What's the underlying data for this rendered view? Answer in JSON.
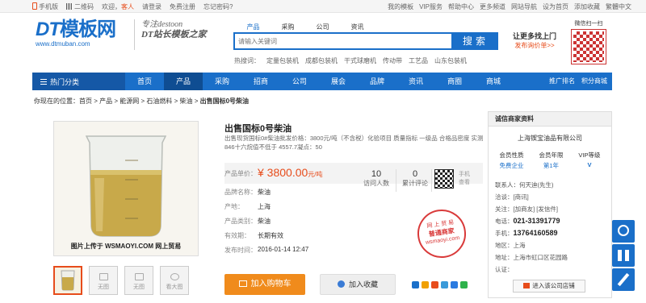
{
  "topbar": {
    "mobile": "手机版",
    "qrcode": "二维码",
    "welcome_prefix": "欢迎，",
    "guest": "客人",
    "login": "请登录",
    "register": "免费注册",
    "forgot": "忘记密码?",
    "links": [
      "我的模板",
      "VIP服务",
      "帮助中心",
      "更多频道",
      "网站导航",
      "设为首页",
      "添加收藏",
      "繁體中文"
    ]
  },
  "header": {
    "logo_text": "模板网",
    "logo_prefix": "DT",
    "logo_url": "www.dtmuban.com",
    "slogan_line1": "专注destoon",
    "slogan_line2": "DT站长模板之家",
    "search_tabs": [
      "产品",
      "采购",
      "公司",
      "资讯"
    ],
    "search_placeholder": "请输入关键词",
    "search_button": "搜索",
    "hot_label": "热搜词：",
    "hot_words": [
      "定量包装机",
      "成都包装机",
      "干式球磨机",
      "传动带",
      "工艺品",
      "山东包装机"
    ],
    "promo_title": "让更多找上门",
    "promo_link": "发布询价单>>",
    "wechat_label": "微信扫一扫"
  },
  "nav": {
    "category": "热门分类",
    "items": [
      "首页",
      "产品",
      "采购",
      "招商",
      "公司",
      "展会",
      "品牌",
      "资讯",
      "商圈",
      "商城"
    ],
    "active": "产品",
    "right": [
      "推广排名",
      "积分商城"
    ]
  },
  "breadcrumb": {
    "prefix": "你现在的位置：",
    "path": "首页 > 产品 > 能源网 > 石油燃料 > 柴油 >",
    "current": "出售国标0号柴油"
  },
  "gallery": {
    "caption": "图片上传于 WSMAOYI.COM 网上贸易",
    "thumb_labels": [
      "",
      "无图",
      "无图",
      "看大图"
    ]
  },
  "product": {
    "title": "出售国标0号柴油",
    "description": "出售现货国标0#柴油批发价格：3800元/吨（不含税）化验项目 质量指标 一级品 合格品密度 实测 846十六烷值不低于 4557.7凝点：50",
    "price_label": "产品单价：",
    "price": "¥ 3800.00",
    "price_unit": "元/吨",
    "brand_label": "品牌名称：",
    "brand": "柴油",
    "origin_label": "产地：",
    "origin": "上海",
    "type_label": "产品类别：",
    "type": "柴油",
    "validity_label": "有效期：",
    "validity": "长期有效",
    "published_label": "发布时间：",
    "published": "2016-01-14 12:47",
    "visitors": "10",
    "visitors_label": "访问人数",
    "comments": "0",
    "comments_label": "累计评论",
    "mobile_view": "手机查看",
    "stamp_top": "网 上 贸 易",
    "stamp_mid": "普通商家",
    "stamp_bottom": "wsmaoyi.com",
    "cart_button": "加入购物车",
    "fav_button": "加入收藏"
  },
  "company": {
    "card_title": "诚信商家资料",
    "name": "上海锲宝油品有限公司",
    "badge1_label": "会员性质",
    "badge1_value": "免费企业",
    "badge2_label": "会员年限",
    "badge2_value": "第1年",
    "badge3_label": "VIP等级",
    "badge3_value": "V",
    "contact": "联系人：何天迪(先生)",
    "chat": "洽谈：[商讯]",
    "follow": "关注：[加商友] [发信件]",
    "phone_label": "电话：",
    "phone": "021-31391779",
    "mobile_label": "手机：",
    "mobile": "13764160589",
    "region_label": "地区：",
    "region": "上海",
    "address_label": "地址：",
    "address": "上海市虹口区花园路",
    "cert_label": "认证：",
    "enter_button": "进入该公司店铺"
  },
  "colors": {
    "brand": "#1a6fc9",
    "accent": "#e74c1b",
    "cart": "#f08b1c"
  }
}
